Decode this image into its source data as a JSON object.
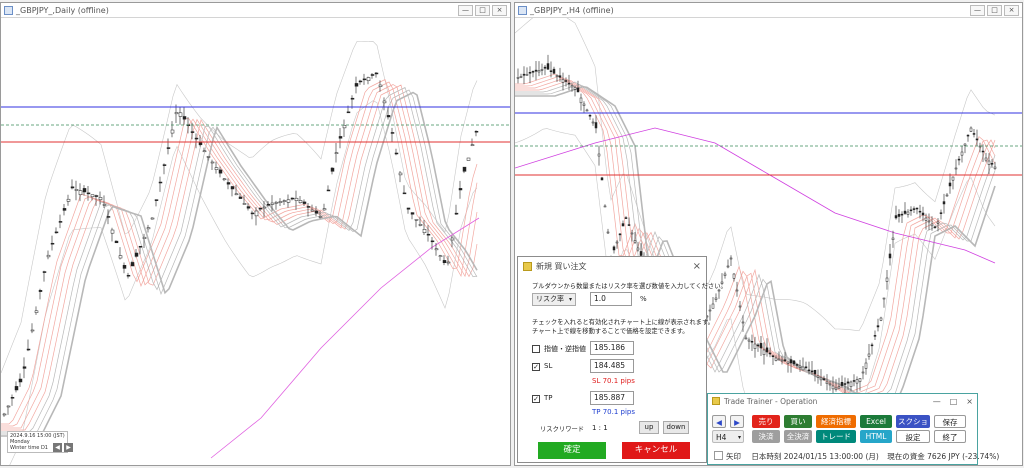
{
  "left_window": {
    "title": "_GBPJPY_,Daily (offline)",
    "info_lines": [
      "2024.9.16  15:00 (JST)",
      "Monday",
      "Winter time  D1"
    ],
    "nav": [
      "◀",
      "▶"
    ]
  },
  "right_window": {
    "title": "_GBPJPY_,H4 (offline)"
  },
  "window_controls": [
    "—",
    "□",
    "×"
  ],
  "order_dialog": {
    "title": "新規 買い注文",
    "close": "×",
    "instruction": "プルダウンから数量またはリスク率を選び数値を入力してください。",
    "mode_select": "リスク率",
    "mode_value": "1.0",
    "mode_unit": "%",
    "note_line1": "チェックを入れると有効化されチャート上に線が表示されます。",
    "note_line2": "チャート上で線を移動することで価格を設定できます。",
    "limit_label": "指値・逆指値",
    "limit_value": "185.186",
    "limit_checked": "",
    "sl_label": "SL",
    "sl_value": "184.485",
    "sl_checked": "✓",
    "sl_pips": "SL 70.1 pips",
    "tp_label": "TP",
    "tp_value": "185.887",
    "tp_checked": "✓",
    "tp_pips": "TP 70.1 pips",
    "rr_label": "リスクリワード",
    "rr_value": "1 : 1",
    "up_label": "up",
    "down_label": "down",
    "ok_label": "確定",
    "cancel_label": "キャンセル"
  },
  "operation_panel": {
    "title": "Trade Trainer - Operation",
    "controls": [
      "—",
      "□",
      "×"
    ],
    "prev": "◀",
    "next": "▶",
    "timeframe": "H4",
    "sell": "売り",
    "buy": "買い",
    "indicators": "経済指標",
    "excel": "Excel",
    "screenshot": "スクショ",
    "save": "保存",
    "settle": "決済",
    "settle_all": "全決済",
    "trade": "トレード",
    "html": "HTML",
    "settings": "設定",
    "quit": "終了",
    "arrow_label": "矢印",
    "time_label": "日本時刻 2024/01/15 13:00:00 (月)",
    "funds_label": "現在の資金 7626 JPY (-23.74%)"
  },
  "colors": {
    "sell": "#e2231a",
    "buy": "#2e7d32",
    "indicators": "#ef6c00",
    "excel": "#1b7a3a",
    "screenshot": "#3a52c4",
    "trade": "#00897b",
    "html": "#26a6c9",
    "ok": "#22aa22",
    "cancel": "#e01818",
    "blue_line": "#3030e0",
    "red_line": "#e03030"
  }
}
